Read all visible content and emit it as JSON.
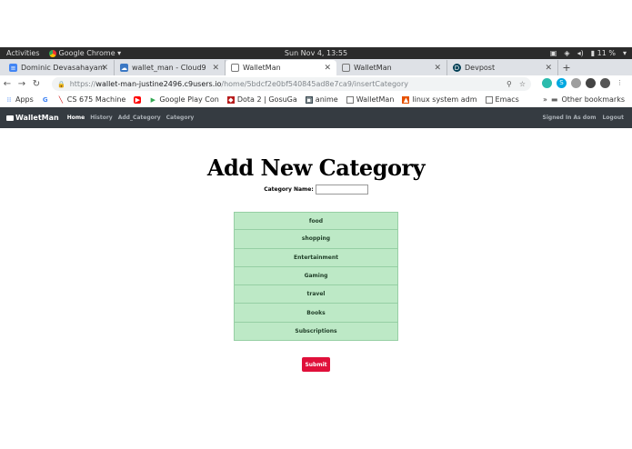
{
  "os": {
    "activities": "Activities",
    "app_menu": "Google Chrome ▾",
    "clock": "Sun Nov  4, 13:55",
    "battery": "11 %"
  },
  "tabs": [
    {
      "title": "Dominic Devasahayam",
      "icon": "docs-icon",
      "active": false
    },
    {
      "title": "wallet_man - Cloud9",
      "icon": "cloud9-icon",
      "active": false
    },
    {
      "title": "WalletMan",
      "icon": "page-icon",
      "active": true
    },
    {
      "title": "WalletMan",
      "icon": "page-icon",
      "active": false
    },
    {
      "title": "Devpost",
      "icon": "devpost-icon",
      "active": false
    }
  ],
  "address": {
    "scheme": "https://",
    "host": "wallet-man-justine2496.c9users.io",
    "path": "/home/5bdcf2e0bf540845ad8e7ca9/insertCategory"
  },
  "bookmarks": [
    {
      "label": "Apps",
      "icon": "apps-grid-icon"
    },
    {
      "label": "",
      "icon": "google-icon"
    },
    {
      "label": "CS 675 Machine",
      "icon": "cs-icon"
    },
    {
      "label": "",
      "icon": "youtube-icon"
    },
    {
      "label": "Google Play Con",
      "icon": "play-icon"
    },
    {
      "label": "Dota 2 | GosuGa",
      "icon": "dota-icon"
    },
    {
      "label": "anime",
      "icon": "anime-icon"
    },
    {
      "label": "WalletMan",
      "icon": "page-icon"
    },
    {
      "label": "linux system adm",
      "icon": "linux-icon"
    },
    {
      "label": "Emacs",
      "icon": "page-icon"
    }
  ],
  "other_bookmarks": "Other bookmarks",
  "app": {
    "brand": "WalletMan",
    "nav": [
      "Home",
      "History",
      "Add_Category",
      "Category"
    ],
    "signed_in": "Signed In As dom",
    "logout": "Logout"
  },
  "page": {
    "title": "Add New Category",
    "field_label": "Category Name:",
    "field_value": "",
    "categories": [
      "food",
      "shopping",
      "Entertainment",
      "Gaming",
      "travel",
      "Books",
      "Subscriptions"
    ],
    "submit": "Submit"
  },
  "colors": {
    "nav_bg": "#353b41",
    "category_bg": "#bde9c6",
    "submit_bg": "#e0103a"
  }
}
